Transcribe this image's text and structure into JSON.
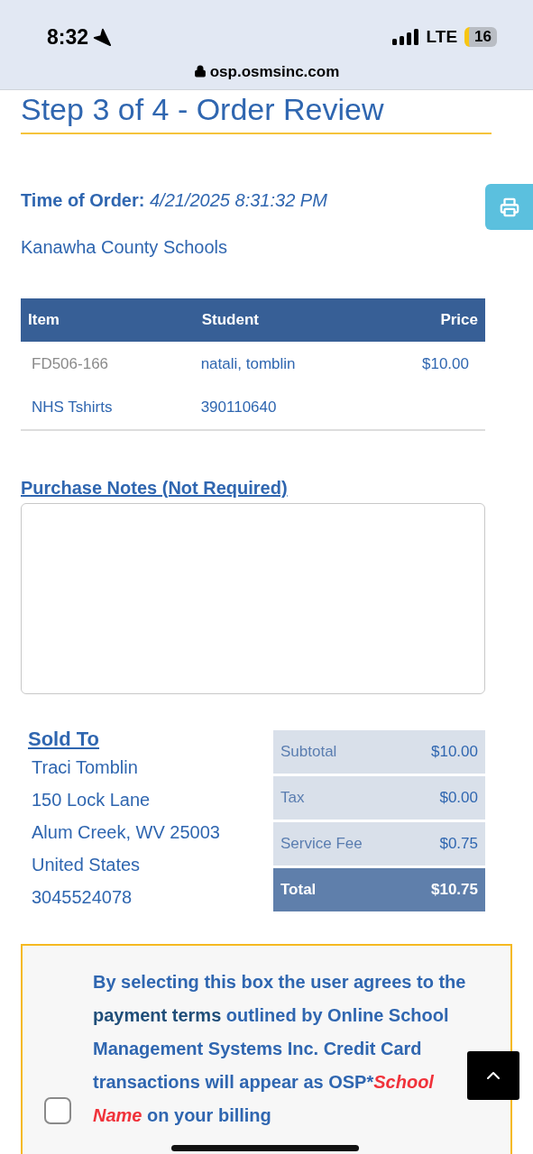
{
  "status_bar": {
    "time": "8:32",
    "network": "LTE",
    "battery": "16"
  },
  "address_bar": {
    "url": "osp.osmsinc.com"
  },
  "page": {
    "title": "Step 3 of 4 - Order Review",
    "time_label": "Time of Order:",
    "time_value": "4/21/2025 8:31:32 PM",
    "school": "Kanawha County Schools"
  },
  "table": {
    "columns": [
      "Item",
      "Student",
      "Price"
    ],
    "rows": [
      {
        "cells": [
          "FD506-166",
          "natali, tomblin",
          "$10.00"
        ],
        "kind": "code"
      },
      {
        "cells": [
          "NHS Tshirts",
          "390110640",
          ""
        ],
        "kind": "name"
      }
    ]
  },
  "notes": {
    "label": "Purchase Notes (Not Required)"
  },
  "sold_to": {
    "heading": "Sold To",
    "lines": [
      "Traci Tomblin",
      "150 Lock Lane",
      "Alum Creek, WV 25003",
      "United States",
      "3045524078"
    ]
  },
  "totals": [
    {
      "label": "Subtotal",
      "value": "$10.00",
      "kind": "line"
    },
    {
      "label": "Tax",
      "value": "$0.00",
      "kind": "line"
    },
    {
      "label": "Service Fee",
      "value": "$0.75",
      "kind": "line"
    },
    {
      "label": "Total",
      "value": "$10.75",
      "kind": "total"
    }
  ],
  "agreement": {
    "checked": false,
    "parts": [
      {
        "text": "By selecting this box the user agrees to the ",
        "kind": "plain"
      },
      {
        "text": "payment terms",
        "kind": "dark"
      },
      {
        "text": " outlined by Online School Management Systems Inc. Credit Card transactions will appear as OSP*",
        "kind": "plain"
      },
      {
        "text": "School Name",
        "kind": "red"
      },
      {
        "text": " on your billing",
        "kind": "plain"
      }
    ]
  }
}
